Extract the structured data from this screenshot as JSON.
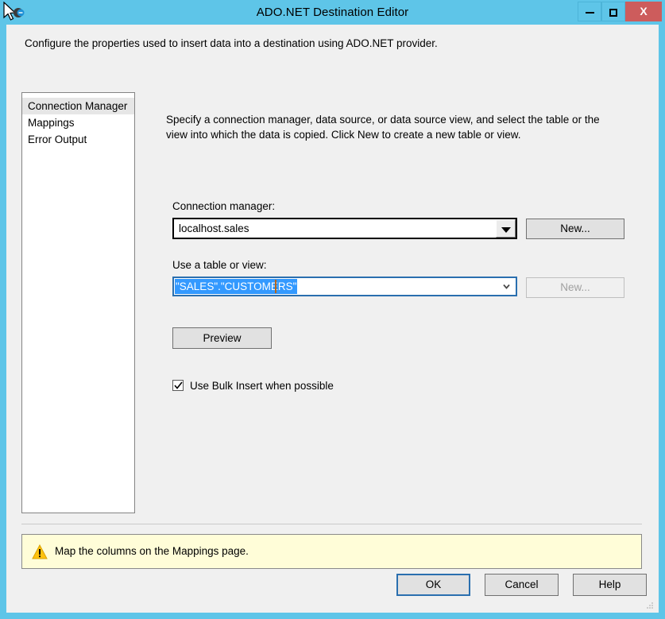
{
  "window": {
    "title": "ADO.NET Destination Editor",
    "minimize_label": "minimize",
    "maximize_label": "maximize",
    "close_label": "X"
  },
  "header": {
    "description": "Configure the properties used to insert data into a destination using ADO.NET provider."
  },
  "sidebar": {
    "items": [
      {
        "label": "Connection Manager",
        "selected": true
      },
      {
        "label": "Mappings",
        "selected": false
      },
      {
        "label": "Error Output",
        "selected": false
      }
    ]
  },
  "main": {
    "intro": "Specify a connection manager, data source, or data source view, and select the table or the view into which the data is copied. Click New to create a new table or view.",
    "connection_manager": {
      "label": "Connection manager:",
      "value": "localhost.sales",
      "new_button": "New..."
    },
    "table_or_view": {
      "label": "Use a table or view:",
      "value": "\"SALES\".\"CUSTOMERS\"",
      "new_button": "New..."
    },
    "preview_button": "Preview",
    "bulk_insert": {
      "label": "Use Bulk Insert when possible",
      "checked": true
    }
  },
  "warning": {
    "icon": "warning-triangle-icon",
    "message": "Map the columns on the Mappings page."
  },
  "footer": {
    "ok": "OK",
    "cancel": "Cancel",
    "help": "Help"
  },
  "colors": {
    "title_bar": "#5ec5e8",
    "close_button": "#cd5c5c",
    "dialog_bg": "#f0f0f0",
    "warning_bg": "#fffdd8",
    "warning_icon": "#ffc20e",
    "selection_blue": "#3399ff",
    "focus_border": "#2a6faf"
  }
}
